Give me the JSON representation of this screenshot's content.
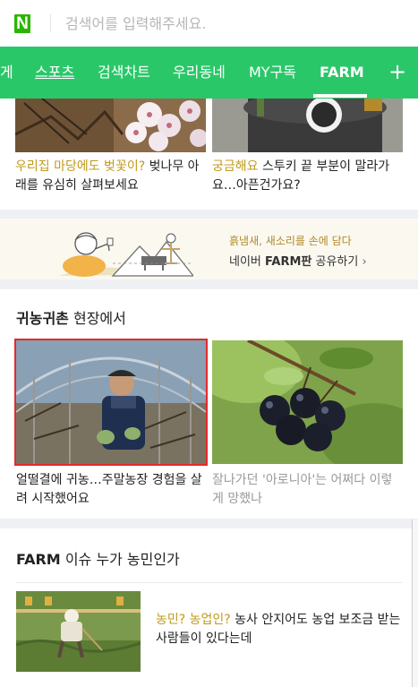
{
  "search": {
    "logo": "N",
    "placeholder": "검색어를 입력해주세요."
  },
  "nav": {
    "items": [
      {
        "label": "게"
      },
      {
        "label": "스포츠"
      },
      {
        "label": "검색차트"
      },
      {
        "label": "우리동네"
      },
      {
        "label": "MY구독"
      },
      {
        "label": "FARM"
      }
    ],
    "active": "FARM",
    "add_label": "+",
    "colors": {
      "bar": "#2ac769",
      "text": "#ffffff"
    }
  },
  "top_cards": [
    {
      "highlight": "우리집 마당에도 벚꽃이?",
      "text": " 벚나무 아래를 유심히 살펴보세요"
    },
    {
      "highlight": "궁금해요",
      "text": " 스투키 끝 부분이 말라가요…아픈건가요?"
    }
  ],
  "banner": {
    "line1": "흙냄새, 새소리를 손에 담다",
    "brand": "네이버 FARM판",
    "link": " 공유하기",
    "chevron": "›"
  },
  "section_farm_life": {
    "title_bold": "귀농귀촌",
    "title_rest": "현장에서",
    "cards": [
      {
        "text": "얼떨결에 귀농…주말농장 경험을 살려 시작했어요",
        "selected": true
      },
      {
        "text": "잘나가던 '아로니아'는 어쩌다 이렇게 망했나",
        "selected": false
      }
    ]
  },
  "section_issue": {
    "title_bold": "FARM",
    "title_mid": "이슈",
    "title_rest": "누가 농민인가",
    "card": {
      "highlight": "농민? 농업인?",
      "text": " 농사 안지어도 농업 보조금 받는 사람들이 있다는데"
    }
  },
  "colors": {
    "accent": "#2ac769",
    "highlight": "#c09a1c",
    "selection": "#e32a2a"
  }
}
